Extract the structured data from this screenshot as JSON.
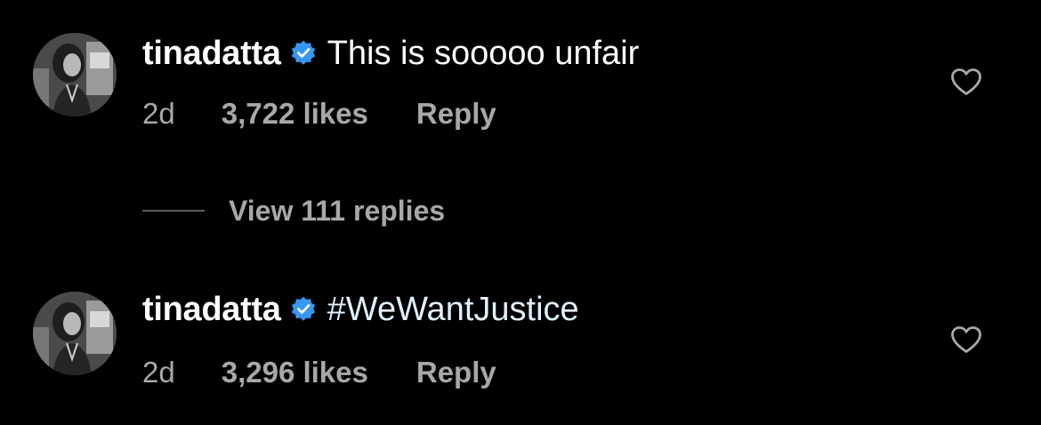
{
  "comments": [
    {
      "username": "tinadatta",
      "verified": true,
      "text": "This is sooooo unfair",
      "time": "2d",
      "likes": "3,722 likes",
      "reply_label": "Reply",
      "liked": false
    },
    {
      "username": "tinadatta",
      "verified": true,
      "text": "#WeWantJustice",
      "time": "2d",
      "likes": "3,296 likes",
      "reply_label": "Reply",
      "liked": false
    }
  ],
  "view_replies": {
    "label": "View 111 replies"
  },
  "colors": {
    "background": "#000000",
    "primary_text": "#ffffff",
    "secondary_text": "#a8a8a8",
    "verified_badge": "#3797f0",
    "hashtag": "#e0f1ff"
  },
  "icons": {
    "verified": "verified-badge-icon",
    "like": "heart-outline-icon"
  }
}
